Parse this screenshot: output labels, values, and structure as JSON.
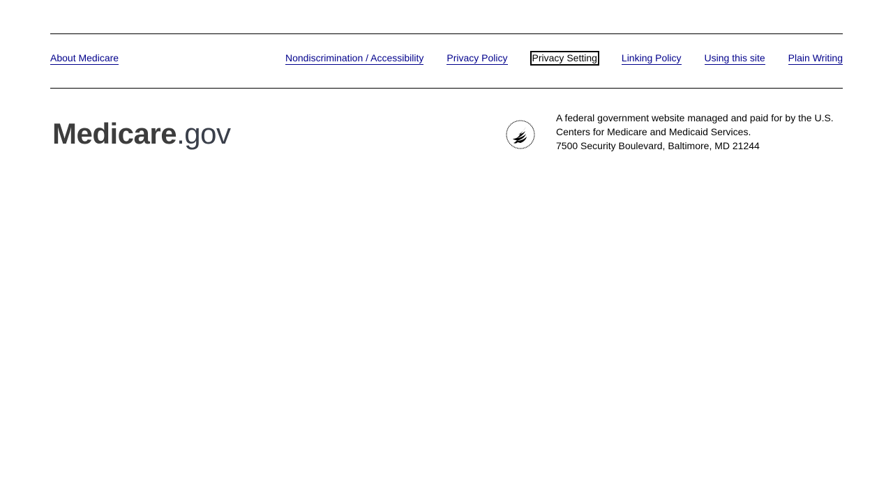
{
  "footer": {
    "about_link": "About Medicare",
    "links": [
      "Nondiscrimination / Accessibility",
      "Privacy Policy",
      "Privacy Setting",
      "Linking Policy",
      "Using this site",
      "Plain Writing"
    ],
    "logo": {
      "brand": "Medicare",
      "tld": ".gov"
    },
    "seal_icon": "hhs-seal-icon",
    "agency_lines": [
      "A federal government website managed and paid for by the U.S.",
      "Centers for Medicare and Medicaid Services.",
      "7500 Security Boulevard, Baltimore, MD 21244"
    ]
  },
  "colors": {
    "link": "#00008b",
    "logo": "#3d3d3d",
    "rule": "#000000"
  }
}
